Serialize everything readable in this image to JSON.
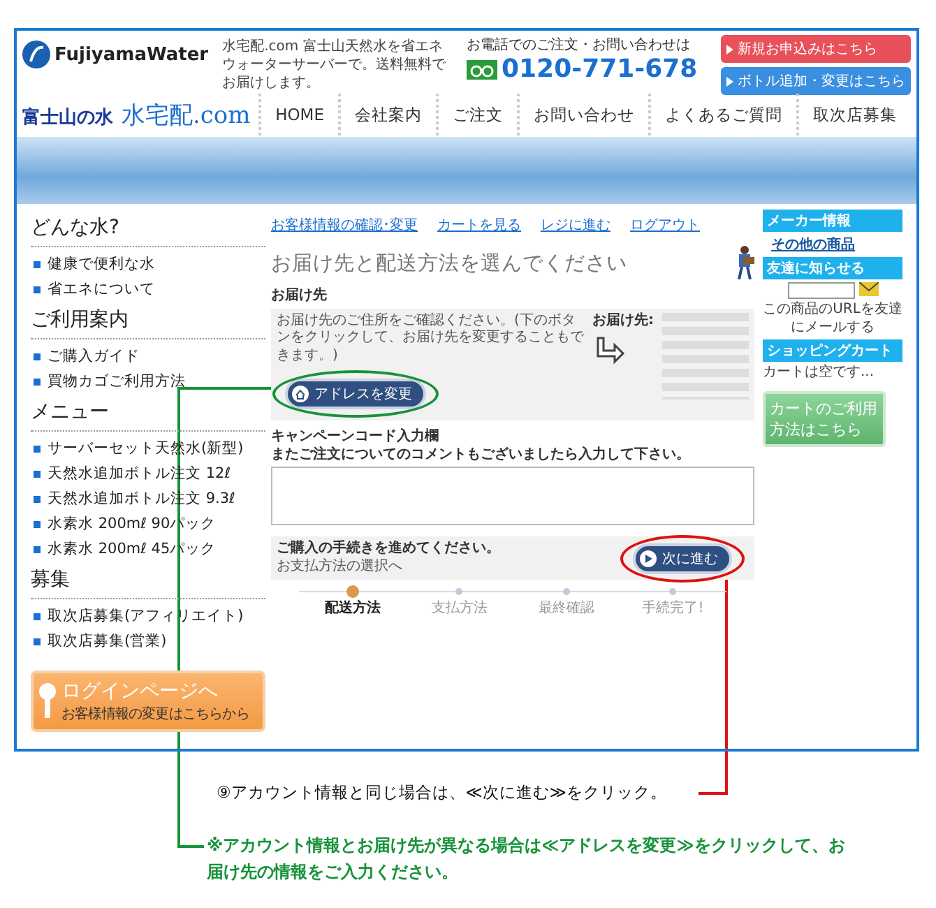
{
  "header": {
    "logo": "FujiyamaWater",
    "tagline": "水宅配.com 富士山天然水を省エネウォーターサーバーで。送料無料でお届けします。",
    "phone_label": "お電話でのご注文・お問い合わせは",
    "phone": "0120-771-678",
    "buttons": [
      "新規お申込みはこちら",
      "ボトル追加・変更はこちら"
    ],
    "brand_small": "富士山の水",
    "brand_big": "水宅配.com"
  },
  "nav": [
    {
      "label": "HOME"
    },
    {
      "label": "会社案内"
    },
    {
      "label": "ご注文"
    },
    {
      "label": "お問い合わせ"
    },
    {
      "label": "よくあるご質問"
    },
    {
      "label": "取次店募集"
    }
  ],
  "sidebar": {
    "sections": [
      {
        "title": "どんな水?",
        "items": [
          "健康で便利な水",
          "省エネについて"
        ]
      },
      {
        "title": "ご利用案内",
        "items": [
          "ご購入ガイド",
          "買物カゴご利用方法"
        ]
      },
      {
        "title": "メニュー",
        "items": [
          "サーバーセット天然水(新型)",
          "天然水追加ボトル注文 12ℓ",
          "天然水追加ボトル注文 9.3ℓ",
          "水素水 200mℓ 90パック",
          "水素水 200mℓ 45パック"
        ]
      },
      {
        "title": "募集",
        "items": [
          "取次店募集(アフィリエイト)",
          "取次店募集(営業)"
        ]
      }
    ],
    "login": {
      "title": "ログインページへ",
      "subtitle": "お客様情報の変更はこちらから"
    }
  },
  "main": {
    "links": [
      "お客様情報の確認･変更",
      "カートを見る",
      "レジに進む",
      "ログアウト"
    ],
    "heading": "お届け先と配送方法を選んでください",
    "address_label": "お届け先",
    "address_note": "お届け先のご住所をご確認ください。(下のボタンをクリックして、お届け先を変更することもできます。)",
    "address_button": "アドレスを変更",
    "address_to": "お届け先:",
    "comment_label": "キャンペーンコード入力欄",
    "comment_hint": "またご注文についてのコメントもございましたら入力して下さい。",
    "proceed_text": "ご購入の手続きを進めてください。",
    "proceed_sub": "お支払方法の選択へ",
    "next_button": "次に進む",
    "steps": [
      {
        "label": "配送方法",
        "selected": true
      },
      {
        "label": "支払方法",
        "selected": false
      },
      {
        "label": "最終確認",
        "selected": false
      },
      {
        "label": "手続完了!",
        "selected": false
      }
    ]
  },
  "right": {
    "maker_title": "メーカー情報",
    "maker_link": "その他の商品",
    "friend_title": "友達に知らせる",
    "friend_note": "この商品のURLを友達にメールする",
    "cart_title": "ショッピングカート",
    "cart_note": "カートは空です...",
    "cart_button": "カートのご利用方法はこちら"
  },
  "annotations": [
    {
      "kind": "red",
      "text": "⑨アカウント情報と同じ場合は、≪次に進む≫をクリック。"
    },
    {
      "kind": "green",
      "text": "※アカウント情報とお届け先が異なる場合は≪アドレスを変更≫をクリックして、お届け先の情報をご入力ください。"
    }
  ]
}
